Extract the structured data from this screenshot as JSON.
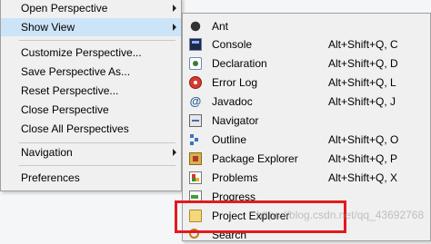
{
  "window_menu": {
    "items": [
      {
        "label": "Open Perspective",
        "has_submenu": true,
        "selected": false
      },
      {
        "label": "Show View",
        "has_submenu": true,
        "selected": true
      },
      {
        "label": "Customize Perspective...",
        "has_submenu": false,
        "selected": false
      },
      {
        "label": "Save Perspective As...",
        "has_submenu": false,
        "selected": false
      },
      {
        "label": "Reset Perspective...",
        "has_submenu": false,
        "selected": false
      },
      {
        "label": "Close Perspective",
        "has_submenu": false,
        "selected": false
      },
      {
        "label": "Close All Perspectives",
        "has_submenu": false,
        "selected": false
      },
      {
        "label": "Navigation",
        "has_submenu": true,
        "selected": false
      },
      {
        "label": "Preferences",
        "has_submenu": false,
        "selected": false
      }
    ]
  },
  "show_view_menu": {
    "items": [
      {
        "label": "Ant",
        "shortcut": "",
        "icon": "ant-icon"
      },
      {
        "label": "Console",
        "shortcut": "Alt+Shift+Q, C",
        "icon": "console-icon"
      },
      {
        "label": "Declaration",
        "shortcut": "Alt+Shift+Q, D",
        "icon": "declaration-icon"
      },
      {
        "label": "Error Log",
        "shortcut": "Alt+Shift+Q, L",
        "icon": "error-log-icon"
      },
      {
        "label": "Javadoc",
        "shortcut": "Alt+Shift+Q, J",
        "icon": "javadoc-icon",
        "glyph": "@"
      },
      {
        "label": "Navigator",
        "shortcut": "",
        "icon": "navigator-icon"
      },
      {
        "label": "Outline",
        "shortcut": "Alt+Shift+Q, O",
        "icon": "outline-icon"
      },
      {
        "label": "Package Explorer",
        "shortcut": "Alt+Shift+Q, P",
        "icon": "package-explorer-icon"
      },
      {
        "label": "Problems",
        "shortcut": "Alt+Shift+Q, X",
        "icon": "problems-icon"
      },
      {
        "label": "Progress",
        "shortcut": "",
        "icon": "progress-icon"
      },
      {
        "label": "Project Explorer",
        "shortcut": "",
        "icon": "project-explorer-icon"
      },
      {
        "label": "Search",
        "shortcut": "",
        "icon": "search-icon"
      }
    ]
  },
  "watermark": "https://blog.csdn.net/qq_43692768",
  "colors": {
    "highlight_border": "#e4191e",
    "selected_bg": "#cce4f7",
    "menu_bg": "#f0f0f0"
  }
}
